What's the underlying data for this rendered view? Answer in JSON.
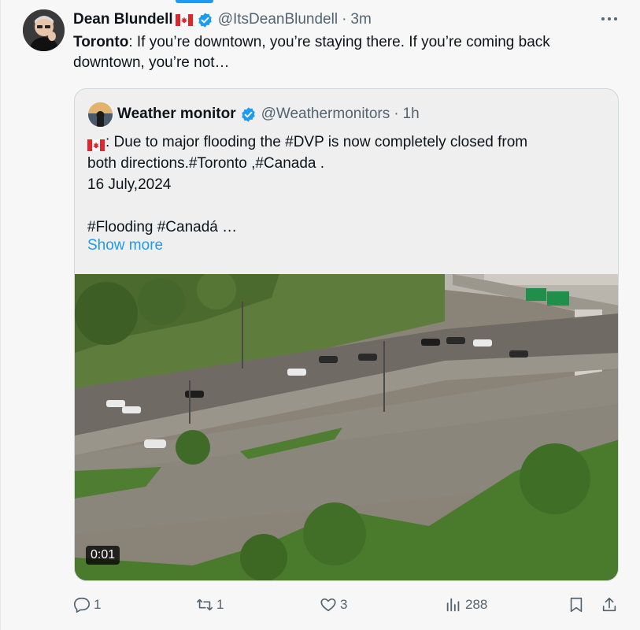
{
  "tweet": {
    "author_name": "Dean Blundell",
    "author_handle": "@ItsDeanBlundell",
    "separator": "·",
    "time": "3m",
    "text_bold": "Toronto",
    "text_rest": ": If you’re downtown, you’re staying there. If you’re coming back downtown, you’re not…"
  },
  "quote": {
    "author_name": "Weather monitor",
    "author_handle": "@Weathermonitors",
    "separator": "·",
    "time": "1h",
    "lines": [
      ": Due to major flooding the #DVP is now completely closed from",
      "both directions.#Toronto ,#Canada .",
      "16 July,2024",
      "",
      "#Flooding #Canadá …"
    ],
    "show_more": "Show more",
    "video_timestamp": "0:01"
  },
  "actions": {
    "replies": "1",
    "reposts": "1",
    "likes": "3",
    "views": "288"
  },
  "colors": {
    "accent": "#1d9bf0",
    "secondary_text": "#536471",
    "verified": "#1d9bf0"
  },
  "icons": [
    "more-icon",
    "verified-icon",
    "canada-flag-icon",
    "reply-icon",
    "repost-icon",
    "like-icon",
    "views-icon",
    "bookmark-icon",
    "share-icon"
  ]
}
